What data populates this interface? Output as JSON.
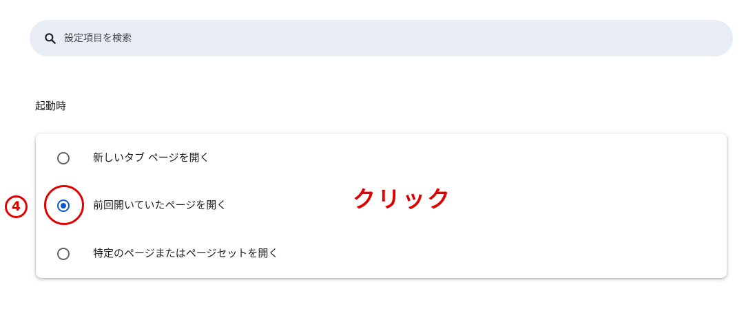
{
  "search": {
    "placeholder": "設定項目を検索",
    "icon": "search-icon"
  },
  "startup": {
    "title": "起動時",
    "options": [
      {
        "label": "新しいタブ ページを開く",
        "checked": false
      },
      {
        "label": "前回開いていたページを開く",
        "checked": true
      },
      {
        "label": "特定のページまたはページセットを開く",
        "checked": false
      }
    ]
  },
  "annotation": {
    "step_number": "4",
    "callout": "クリック",
    "color": "#e00000"
  },
  "colors": {
    "accent": "#0b57d0",
    "search_bg": "#e9eef6"
  }
}
